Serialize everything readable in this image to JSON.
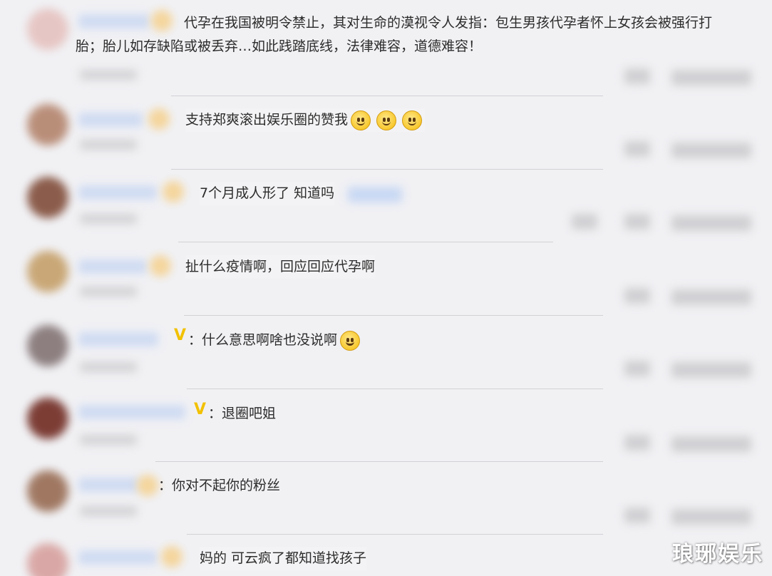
{
  "comments": [
    {
      "text": "代孕在我国被明令禁止，其对生命的漠视令人发指：包生男孩代孕者怀上女孩会被强行打胎；胎儿如存缺陷或被丢弃…如此践踏底线，法律难容，道德难容！"
    },
    {
      "text": "支持郑爽滚出娱乐圈的赞我",
      "emojis": [
        "smile-emoji",
        "smile-emoji",
        "smile-emoji"
      ]
    },
    {
      "text": "7个月成人形了 知道吗"
    },
    {
      "text": "扯什么疫情啊，回应回应代孕啊"
    },
    {
      "prefix": "：",
      "text": "什么意思啊啥也没说啊",
      "emojis": [
        "grin-emoji"
      ]
    },
    {
      "prefix": "：",
      "text": "退圈吧姐"
    },
    {
      "prefix": "：",
      "text": "你对不起你的粉丝"
    },
    {
      "text": "妈的 可云疯了都知道找孩子"
    }
  ],
  "vip_mark": "V",
  "watermark": "琅琊娱乐",
  "colors": {
    "background": "#f1f1f4",
    "text": "#2c2c2c",
    "vip": "#f2c100",
    "name_blur": "#c7d6f2"
  }
}
